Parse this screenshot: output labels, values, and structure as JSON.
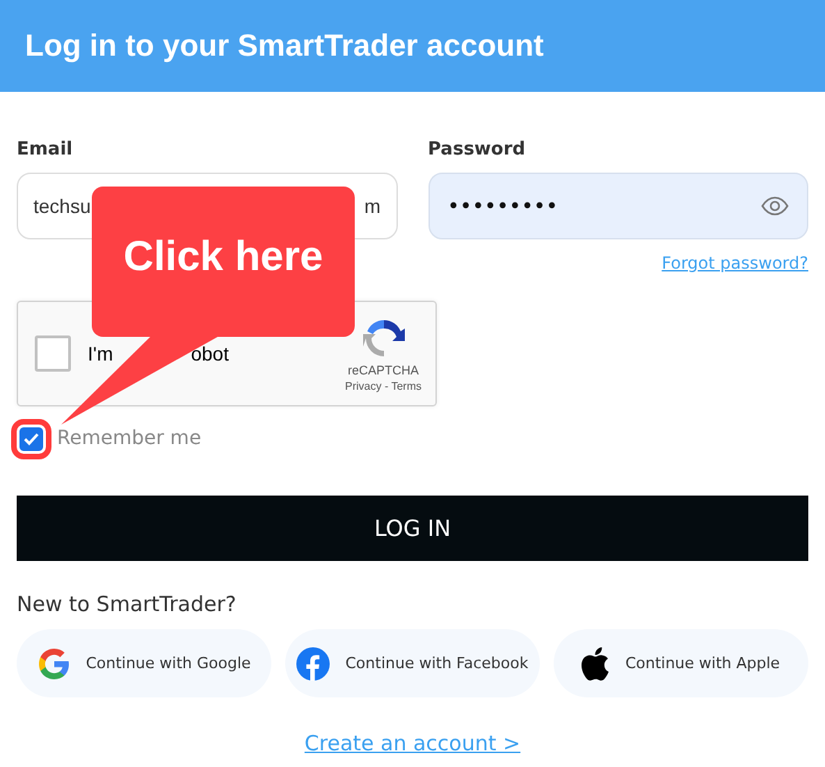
{
  "header": {
    "title": "Log in to your SmartTrader account"
  },
  "email": {
    "label": "Email",
    "value_start": "techsu",
    "value_end": "m"
  },
  "password": {
    "label": "Password",
    "value": "•••••••••"
  },
  "forgot_link": "Forgot password?",
  "captcha": {
    "checked": false,
    "label_start": "I'm",
    "label_end": "obot",
    "brand": "reCAPTCHA",
    "links": "Privacy - Terms"
  },
  "remember": {
    "label": "Remember me",
    "checked": true
  },
  "login_button": "LOG IN",
  "signup_prompt": "New to SmartTrader?",
  "social_buttons": [
    {
      "kind": "google",
      "label": "Continue with Google"
    },
    {
      "kind": "facebook",
      "label": "Continue with Facebook"
    },
    {
      "kind": "apple",
      "label": "Continue with Apple"
    }
  ],
  "create_link": "Create an account >",
  "callout": {
    "text": "Click here"
  }
}
